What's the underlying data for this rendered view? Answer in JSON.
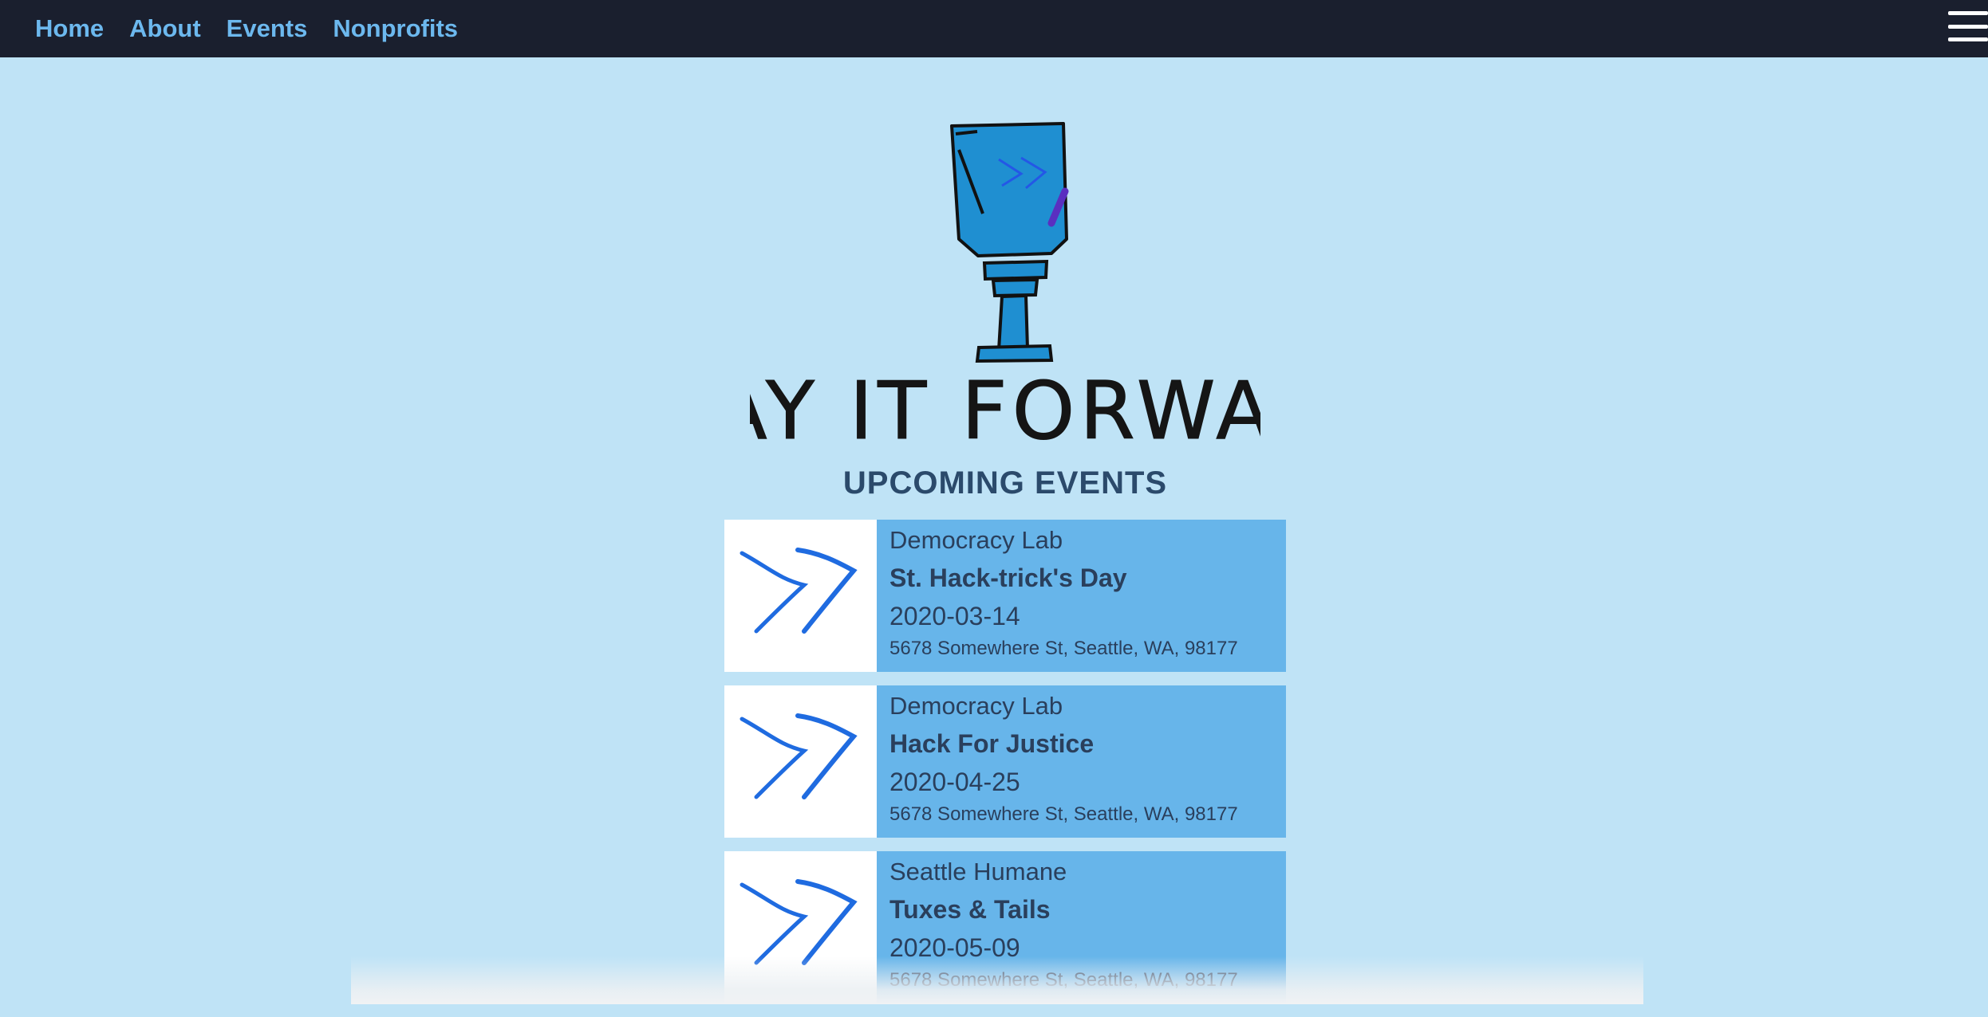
{
  "nav": {
    "links": [
      "Home",
      "About",
      "Events",
      "Nonprofits"
    ]
  },
  "brand": {
    "logo_text": "PLAY IT FORWARD"
  },
  "section": {
    "title": "UPCOMING EVENTS"
  },
  "events": [
    {
      "org": "Democracy Lab",
      "name": "St. Hack-trick's Day",
      "date": "2020-03-14",
      "address": "5678 Somewhere St, Seattle, WA, 98177"
    },
    {
      "org": "Democracy Lab",
      "name": "Hack For Justice",
      "date": "2020-04-25",
      "address": "5678 Somewhere St, Seattle, WA, 98177"
    },
    {
      "org": "Seattle Humane",
      "name": "Tuxes & Tails",
      "date": "2020-05-09",
      "address": "5678 Somewhere St, Seattle, WA, 98177"
    }
  ],
  "colors": {
    "page_bg": "#bfe3f6",
    "nav_bg": "#1a1f2e",
    "nav_link": "#6cb8ee",
    "card_bg": "#67b5ea",
    "card_text": "#2a3f5c",
    "heading": "#2b4a6b",
    "arrow_icon": "#1f6be0"
  },
  "icons": [
    "hamburger-menu-icon",
    "trophy-logo-icon",
    "double-chevron-icon"
  ]
}
